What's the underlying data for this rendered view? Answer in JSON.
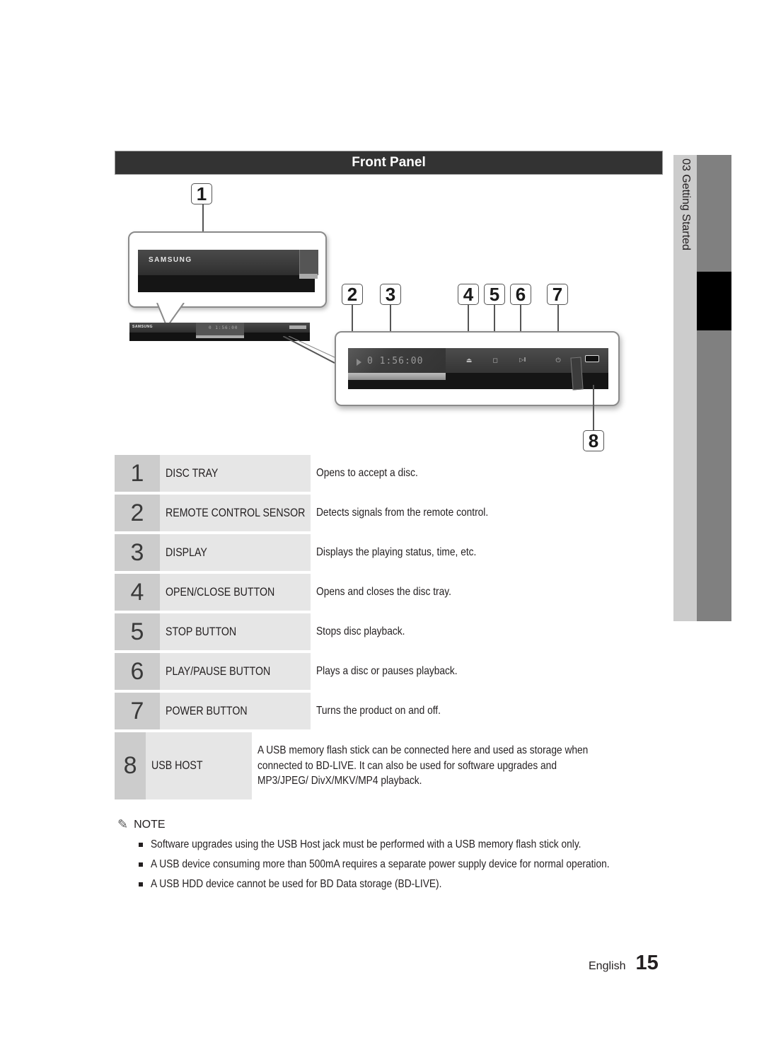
{
  "section": {
    "title": "Front Panel"
  },
  "side_tab": {
    "label": "03  Getting Started"
  },
  "diagram": {
    "brand": "SAMSUNG",
    "display_readout": "0 1:56:00",
    "callouts": [
      "1",
      "2",
      "3",
      "4",
      "5",
      "6",
      "7",
      "8"
    ],
    "button_icons": [
      "eject-icon",
      "stop-icon",
      "play-pause-icon",
      "power-icon"
    ],
    "button_glyphs": [
      "⏏",
      "◻",
      "▷ǁ",
      "⏻"
    ]
  },
  "table": {
    "rows": [
      {
        "num": "1",
        "name": "DISC TRAY",
        "desc": "Opens to accept a disc."
      },
      {
        "num": "2",
        "name": "REMOTE CONTROL SENSOR",
        "desc": "Detects signals from the remote control."
      },
      {
        "num": "3",
        "name": "DISPLAY",
        "desc": "Displays the playing status, time, etc."
      },
      {
        "num": "4",
        "name": "OPEN/CLOSE BUTTON",
        "desc": "Opens and closes the disc tray."
      },
      {
        "num": "5",
        "name": "STOP BUTTON",
        "desc": "Stops disc playback."
      },
      {
        "num": "6",
        "name": "PLAY/PAUSE BUTTON",
        "desc": "Plays a disc or pauses playback."
      },
      {
        "num": "7",
        "name": "POWER BUTTON",
        "desc": "Turns the product on and off."
      },
      {
        "num": "8",
        "name": "USB HOST",
        "desc": "A USB memory flash stick can be connected here and used as storage when connected to BD-LIVE. It can also be used for software upgrades and MP3/JPEG/ DivX/MKV/MP4 playback."
      }
    ]
  },
  "note": {
    "icon": "pencil-icon",
    "icon_glyph": "✎",
    "title": "NOTE",
    "items": [
      "Software upgrades using the USB Host jack must be performed with a USB memory flash stick only.",
      "A USB device consuming more than 500mA requires a separate power supply device for normal operation.",
      "A USB HDD device cannot be used for BD Data storage (BD-LIVE)."
    ]
  },
  "footer": {
    "language": "English",
    "page_number": "15"
  },
  "colors": {
    "header_bar": "#333333",
    "number_cell": "#cccccc",
    "name_cell": "#e6e6e6",
    "side_tab_light": "#cccccc",
    "side_tab_dark": "#808080",
    "side_tab_active": "#000000"
  }
}
